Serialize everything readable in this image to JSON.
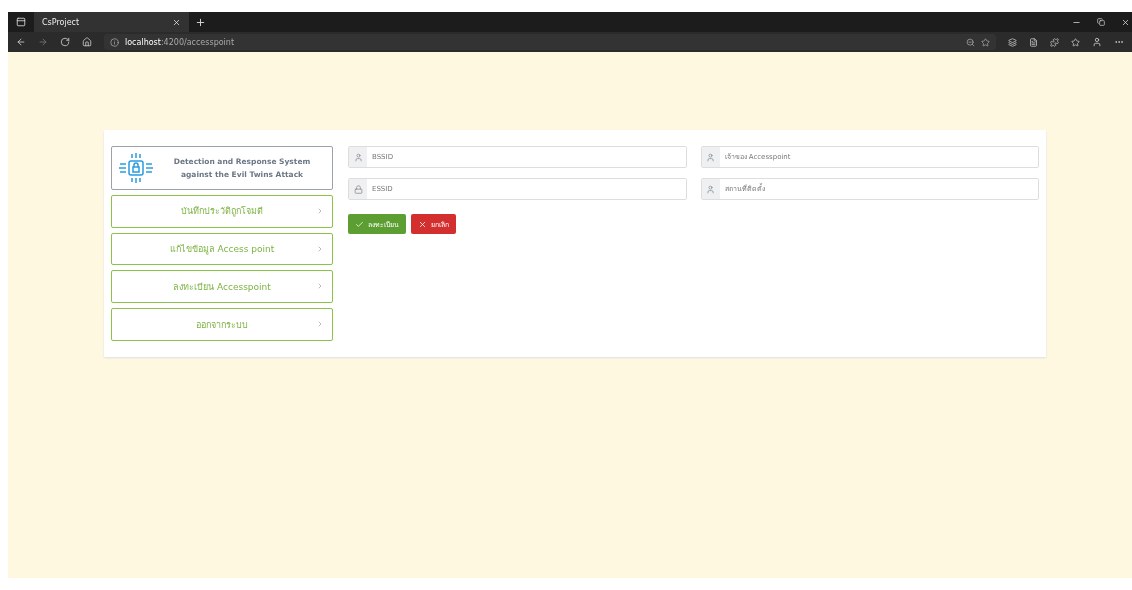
{
  "browser": {
    "tab_title": "CsProject",
    "url_host": "localhost",
    "url_path": ":4200/accesspoint"
  },
  "sidebar": {
    "title": "Detection and Response System against the Evil Twins Attack",
    "items": [
      {
        "label": "บันทึกประวัติถูกโจมตี"
      },
      {
        "label": "แก้ไขข้อมูล Access point"
      },
      {
        "label": "ลงทะเบียน Accesspoint"
      },
      {
        "label": "ออกจากระบบ"
      }
    ]
  },
  "form": {
    "fields": [
      {
        "placeholder": "BSSID",
        "kind": "person"
      },
      {
        "placeholder": "เจ้าของ Accesspoint",
        "kind": "person"
      },
      {
        "placeholder": "ESSID",
        "kind": "secret"
      },
      {
        "placeholder": "สถานที่ติดตั้ง",
        "kind": "person"
      }
    ],
    "buttons": [
      {
        "label": "ลงทะเบียน",
        "kind": "submit"
      },
      {
        "label": "ยกเลิก",
        "kind": "cancel"
      }
    ]
  }
}
